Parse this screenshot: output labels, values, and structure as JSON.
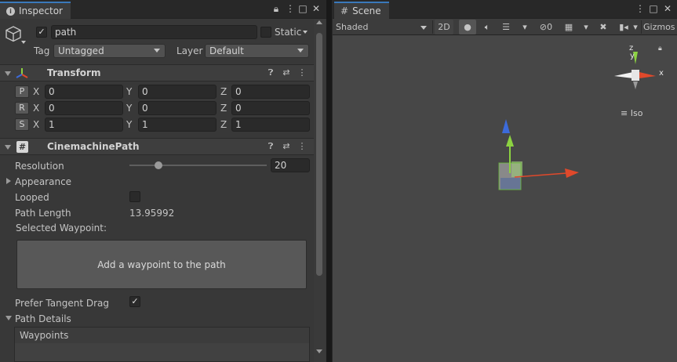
{
  "inspector": {
    "tab_label": "Inspector",
    "object": {
      "name": "path",
      "active": true,
      "static_label": "Static",
      "tag_label": "Tag",
      "tag_value": "Untagged",
      "layer_label": "Layer",
      "layer_value": "Default"
    },
    "transform": {
      "title": "Transform",
      "rows": [
        {
          "btn": "P",
          "x": "0",
          "y": "0",
          "z": "0"
        },
        {
          "btn": "R",
          "x": "0",
          "y": "0",
          "z": "0"
        },
        {
          "btn": "S",
          "x": "1",
          "y": "1",
          "z": "1"
        }
      ],
      "axis_x": "X",
      "axis_y": "Y",
      "axis_z": "Z"
    },
    "cinemachine": {
      "title": "CinemachinePath",
      "resolution_label": "Resolution",
      "resolution_value": "20",
      "resolution_slider_fraction": 0.21,
      "appearance_label": "Appearance",
      "looped_label": "Looped",
      "looped": false,
      "path_length_label": "Path Length",
      "path_length_value": "13.95992",
      "selected_waypoint_label": "Selected Waypoint:",
      "add_waypoint_label": "Add a waypoint to the path",
      "prefer_tangent_label": "Prefer Tangent Drag",
      "prefer_tangent": true,
      "path_details_label": "Path Details",
      "waypoints_label": "Waypoints"
    }
  },
  "scene": {
    "tab_label": "Scene",
    "shading_mode": "Shaded",
    "btn_2d": "2D",
    "hidden_count": "0",
    "gizmos_label": "Gizmos",
    "iso_label": "Iso",
    "gizmo_axis_y": "y",
    "gizmo_axis_z": "z",
    "gizmo_axis_x": "x"
  },
  "colors": {
    "x_axis": "#e0492b",
    "y_axis": "#8cd241",
    "z_axis": "#3c6bdb",
    "accent": "#3a79bb"
  }
}
